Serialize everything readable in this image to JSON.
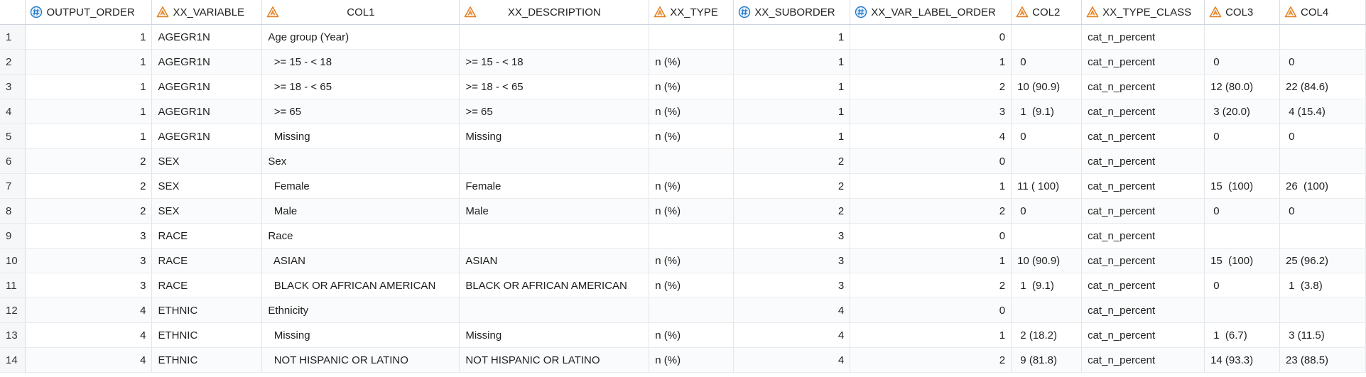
{
  "colors": {
    "numeric_icon": "#1f77d0",
    "char_icon": "#e07b1a",
    "grid_line": "#e3e6ea"
  },
  "columns": [
    {
      "key": "row",
      "label": "",
      "type": "rownum",
      "icon": ""
    },
    {
      "key": "output_order",
      "label": "OUTPUT_ORDER",
      "type": "numeric",
      "icon": "numeric-column-icon"
    },
    {
      "key": "xx_variable",
      "label": "XX_VARIABLE",
      "type": "character",
      "icon": "character-column-icon"
    },
    {
      "key": "col1",
      "label": "COL1",
      "type": "character",
      "icon": "character-column-icon"
    },
    {
      "key": "xx_description",
      "label": "XX_DESCRIPTION",
      "type": "character",
      "icon": "character-column-icon"
    },
    {
      "key": "xx_type",
      "label": "XX_TYPE",
      "type": "character",
      "icon": "character-column-icon"
    },
    {
      "key": "xx_suborder",
      "label": "XX_SUBORDER",
      "type": "numeric",
      "icon": "numeric-column-icon"
    },
    {
      "key": "xx_var_label_order",
      "label": "XX_VAR_LABEL_ORDER",
      "type": "numeric",
      "icon": "numeric-column-icon"
    },
    {
      "key": "col2",
      "label": "COL2",
      "type": "character",
      "icon": "character-column-icon"
    },
    {
      "key": "xx_type_class",
      "label": "XX_TYPE_CLASS",
      "type": "character",
      "icon": "character-column-icon"
    },
    {
      "key": "col3",
      "label": "COL3",
      "type": "character",
      "icon": "character-column-icon"
    },
    {
      "key": "col4",
      "label": "COL4",
      "type": "character",
      "icon": "character-column-icon"
    }
  ],
  "rows": [
    [
      "1",
      "1",
      "AGEGR1N",
      "Age group (Year)",
      "",
      "",
      "1",
      "0",
      "",
      "cat_n_percent",
      "",
      ""
    ],
    [
      "2",
      "1",
      "AGEGR1N",
      "  >= 15 - < 18",
      ">= 15 - < 18",
      "n (%)",
      "1",
      "1",
      " 0",
      "cat_n_percent",
      " 0",
      " 0"
    ],
    [
      "3",
      "1",
      "AGEGR1N",
      "  >= 18 - < 65",
      ">= 18 - < 65",
      "n (%)",
      "1",
      "2",
      "10 (90.9)",
      "cat_n_percent",
      "12 (80.0)",
      "22 (84.6)"
    ],
    [
      "4",
      "1",
      "AGEGR1N",
      "  >= 65",
      ">= 65",
      "n (%)",
      "1",
      "3",
      " 1  (9.1)",
      "cat_n_percent",
      " 3 (20.0)",
      " 4 (15.4)"
    ],
    [
      "5",
      "1",
      "AGEGR1N",
      "  Missing",
      "Missing",
      "n (%)",
      "1",
      "4",
      " 0",
      "cat_n_percent",
      " 0",
      " 0"
    ],
    [
      "6",
      "2",
      "SEX",
      "Sex",
      "",
      "",
      "2",
      "0",
      "",
      "cat_n_percent",
      "",
      ""
    ],
    [
      "7",
      "2",
      "SEX",
      "  Female",
      "Female",
      "n (%)",
      "2",
      "1",
      "11 ( 100)",
      "cat_n_percent",
      "15  (100)",
      "26  (100)"
    ],
    [
      "8",
      "2",
      "SEX",
      "  Male",
      "Male",
      "n (%)",
      "2",
      "2",
      " 0",
      "cat_n_percent",
      " 0",
      " 0"
    ],
    [
      "9",
      "3",
      "RACE",
      "Race",
      "",
      "",
      "3",
      "0",
      "",
      "cat_n_percent",
      "",
      ""
    ],
    [
      "10",
      "3",
      "RACE",
      "  ASIAN",
      "ASIAN",
      "n (%)",
      "3",
      "1",
      "10 (90.9)",
      "cat_n_percent",
      "15  (100)",
      "25 (96.2)"
    ],
    [
      "11",
      "3",
      "RACE",
      "  BLACK OR AFRICAN AMERICAN",
      "BLACK OR AFRICAN AMERICAN",
      "n (%)",
      "3",
      "2",
      " 1  (9.1)",
      "cat_n_percent",
      " 0",
      " 1  (3.8)"
    ],
    [
      "12",
      "4",
      "ETHNIC",
      "Ethnicity",
      "",
      "",
      "4",
      "0",
      "",
      "cat_n_percent",
      "",
      ""
    ],
    [
      "13",
      "4",
      "ETHNIC",
      "  Missing",
      "Missing",
      "n (%)",
      "4",
      "1",
      " 2 (18.2)",
      "cat_n_percent",
      " 1  (6.7)",
      " 3 (11.5)"
    ],
    [
      "14",
      "4",
      "ETHNIC",
      "  NOT HISPANIC OR LATINO",
      "NOT HISPANIC OR LATINO",
      "n (%)",
      "4",
      "2",
      " 9 (81.8)",
      "cat_n_percent",
      "14 (93.3)",
      "23 (88.5)"
    ]
  ]
}
